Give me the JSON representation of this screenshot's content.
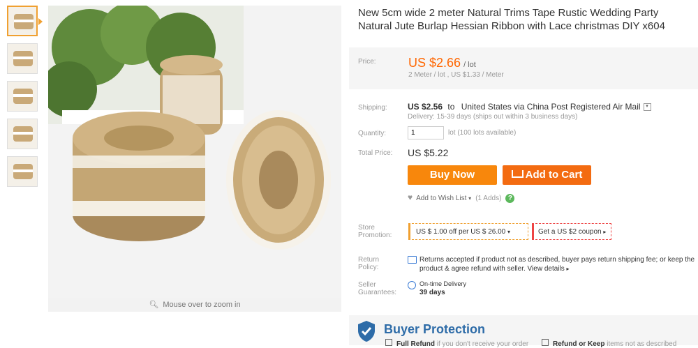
{
  "product": {
    "title": "New 5cm wide 2 meter Natural Trims Tape Rustic Wedding Party Natural Jute Burlap Hessian Ribbon with Lace christmas DIY x604"
  },
  "gallery": {
    "zoom_hint": "Mouse over to zoom in",
    "thumbnail_count": 5
  },
  "price": {
    "label": "Price:",
    "value": "US $2.66",
    "unit": "/ lot",
    "sub": "2 Meter / lot , US $1.33 / Meter"
  },
  "shipping": {
    "label": "Shipping:",
    "price": "US $2.56",
    "to": "to",
    "destination": "United States via China Post Registered Air Mail",
    "delivery": "Delivery: 15-39 days (ships out within 3 business days)"
  },
  "quantity": {
    "label": "Quantity:",
    "value": "1",
    "note": "lot (100 lots available)"
  },
  "total": {
    "label": "Total Price:",
    "value": "US $5.22"
  },
  "actions": {
    "buy_now": "Buy Now",
    "add_to_cart": "Add to Cart",
    "wishlist": "Add to Wish List",
    "wishlist_count": "(1 Adds)"
  },
  "promotion": {
    "label": "Store Promotion:",
    "coupon1": "US $ 1.00 off per US $ 26.00",
    "coupon2": "Get a US $2 coupon"
  },
  "return_policy": {
    "label": "Return Policy:",
    "text": "Returns accepted if product not as described, buyer pays return shipping fee; or keep the product & agree refund with seller.",
    "link": "View details"
  },
  "guarantee": {
    "label": "Seller Guarantees:",
    "title": "On-time Delivery",
    "days": "39 days"
  },
  "buyer_protection": {
    "title": "Buyer Protection",
    "item1_bold": "Full Refund",
    "item1_rest": "if you don't receive your order",
    "item2_bold": "Refund or Keep",
    "item2_rest": "items not as described"
  },
  "colors": {
    "accent_orange": "#f60",
    "buy_button": "#f8870c",
    "cart_button": "#f36b11",
    "protection_blue": "#2e6ca8"
  }
}
